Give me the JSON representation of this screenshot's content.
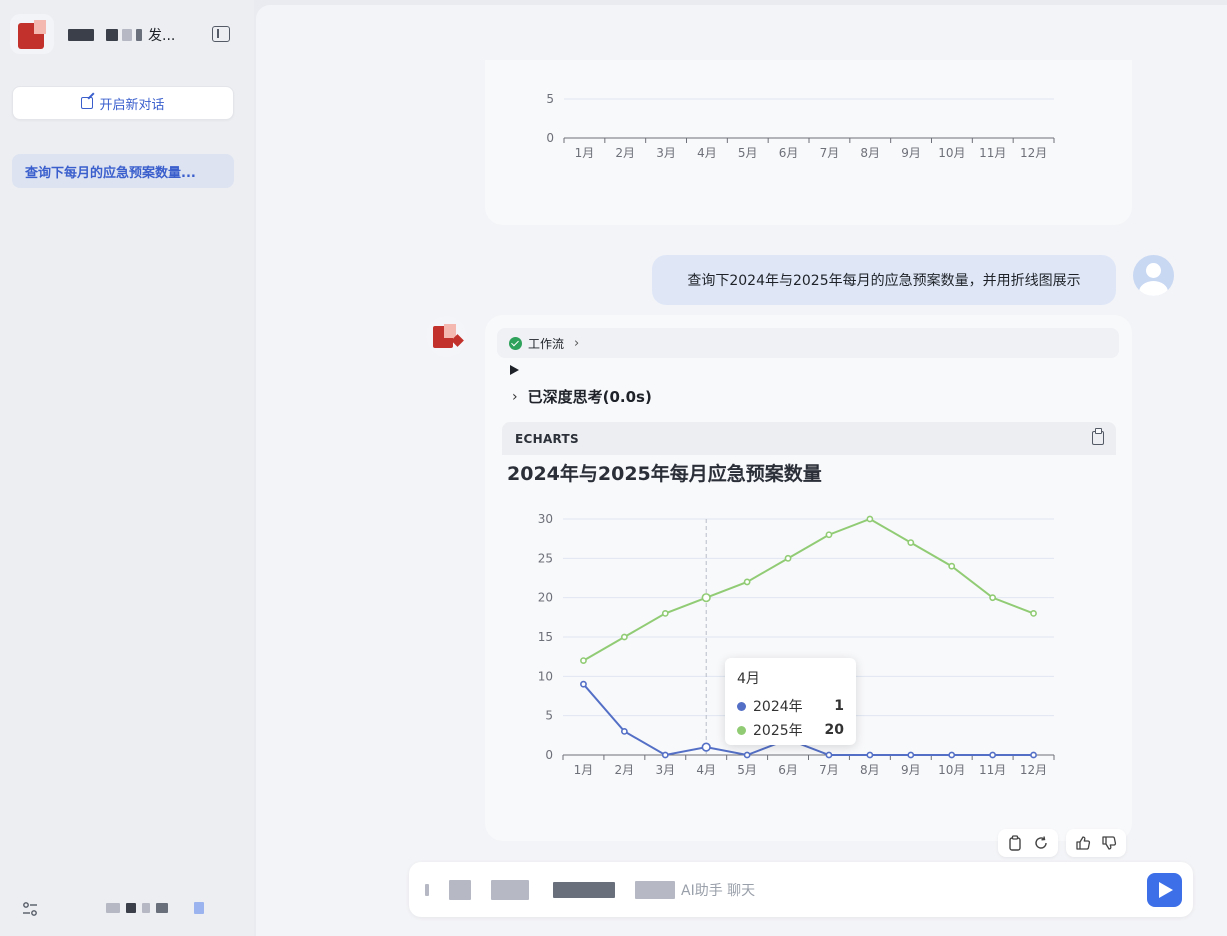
{
  "sidebar": {
    "app_title_suffix": "发...",
    "new_chat_label": "开启新对话",
    "history": [
      {
        "label": "查询下每月的应急预案数量..."
      }
    ]
  },
  "conversation": {
    "user_message": "查询下2024年与2025年每月的应急预案数量，并用折线图展示",
    "workflow_label": "工作流",
    "deep_think_label": "已深度思考(0.0s)",
    "code_block_lang": "ECHARTS"
  },
  "input": {
    "placeholder_visible": "AI助手 聊天"
  },
  "tooltip": {
    "title": "4月",
    "rows": [
      {
        "name": "2024年",
        "value": "1",
        "color": "#5470c6"
      },
      {
        "name": "2025年",
        "value": "20",
        "color": "#91cc75"
      }
    ]
  },
  "colors": {
    "accent": "#3a5fcd",
    "send_button": "#3d6fe8",
    "series_2024": "#5470c6",
    "series_2025": "#91cc75"
  },
  "icons": [
    "collapse-sidebar-icon",
    "edit-icon",
    "settings-icon",
    "check-icon",
    "chevron-right-icon",
    "play-icon",
    "copy-icon",
    "refresh-icon",
    "thumbs-up-icon",
    "thumbs-down-icon",
    "send-icon",
    "user-avatar-icon"
  ],
  "chart_data": [
    {
      "type": "bar",
      "partial": true,
      "title": "",
      "categories": [
        "1月",
        "2月",
        "3月",
        "4月",
        "5月",
        "6月",
        "7月",
        "8月",
        "9月",
        "10月",
        "11月",
        "12月"
      ],
      "visible_yticks": [
        0,
        5
      ]
    },
    {
      "type": "line",
      "title": "2024年与2025年每月应急预案数量",
      "categories": [
        "1月",
        "2月",
        "3月",
        "4月",
        "5月",
        "6月",
        "7月",
        "8月",
        "9月",
        "10月",
        "11月",
        "12月"
      ],
      "series": [
        {
          "name": "2024年",
          "color": "#5470c6",
          "values": [
            9,
            3,
            0,
            1,
            0,
            2,
            0,
            0,
            0,
            0,
            0,
            0
          ]
        },
        {
          "name": "2025年",
          "color": "#91cc75",
          "values": [
            12,
            15,
            18,
            20,
            22,
            25,
            28,
            30,
            27,
            24,
            20,
            18
          ]
        }
      ],
      "ylim": [
        0,
        30
      ],
      "yticks": [
        0,
        5,
        10,
        15,
        20,
        25,
        30
      ],
      "grid": true,
      "highlighted_category": "4月"
    }
  ]
}
